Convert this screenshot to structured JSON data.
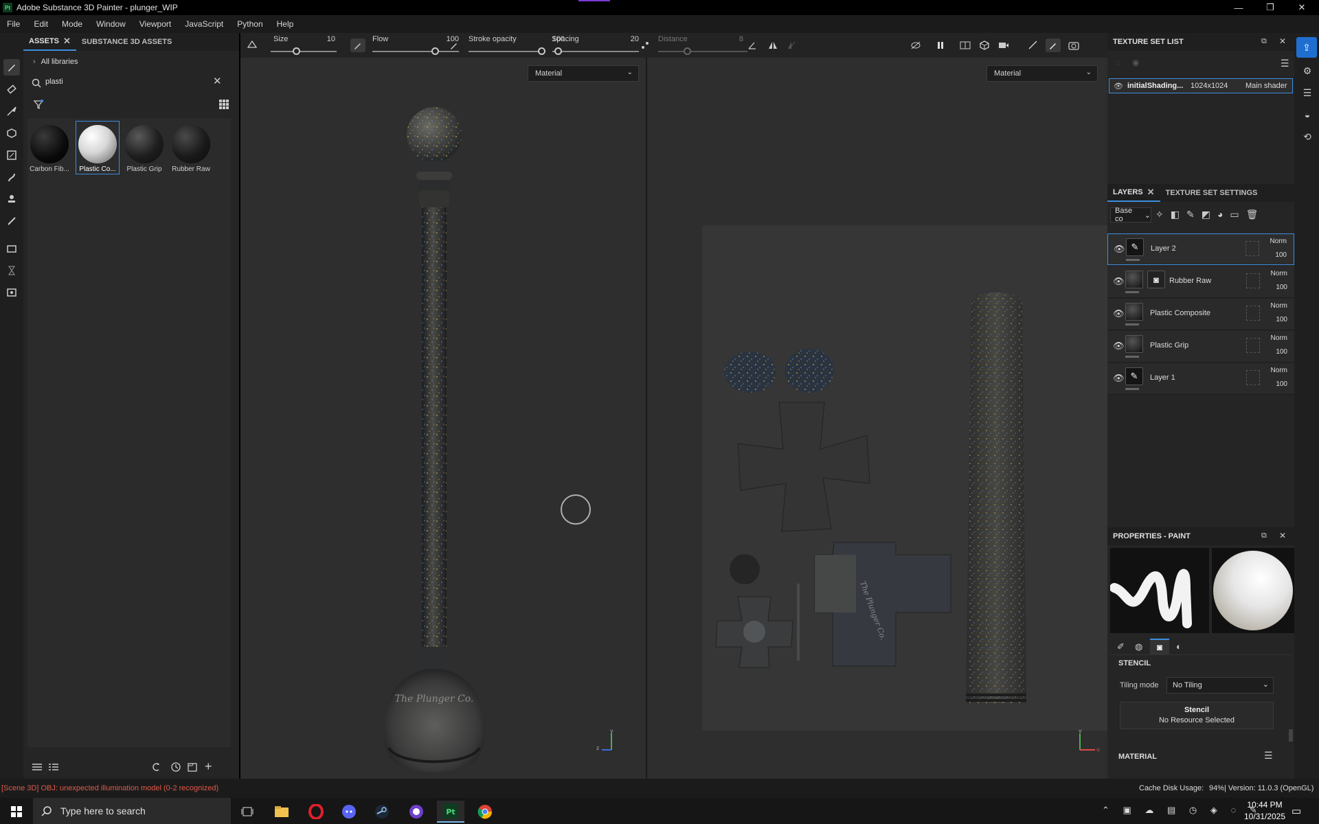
{
  "app": {
    "logo_text": "Pt",
    "title": "Adobe Substance 3D Painter - plunger_WIP"
  },
  "window_controls": {
    "minimize": "—",
    "maximize": "❐",
    "close": "✕"
  },
  "menu": [
    "File",
    "Edit",
    "Mode",
    "Window",
    "Viewport",
    "JavaScript",
    "Python",
    "Help"
  ],
  "assets_panel": {
    "tabs": [
      "ASSETS",
      "SUBSTANCE 3D ASSETS"
    ],
    "breadcrumb": "All libraries",
    "search_value": "plasti",
    "materials": [
      {
        "label": "Carbon Fib..."
      },
      {
        "label": "Plastic Co..."
      },
      {
        "label": "Plastic Grip"
      },
      {
        "label": "Rubber Raw"
      }
    ]
  },
  "toolbar": {
    "size_label": "Size",
    "size_value": "10",
    "flow_label": "Flow",
    "flow_value": "100",
    "stroke_label": "Stroke opacity",
    "stroke_value": "100",
    "spacing_label": "Spacing",
    "spacing_value": "20",
    "distance_label": "Distance",
    "distance_value": "8"
  },
  "viewport": {
    "left_mode": "Material",
    "right_mode": "Material",
    "brand_text": "The Plunger Co."
  },
  "texture_set_list": {
    "title": "TEXTURE SET LIST",
    "set_name": "initialShading...",
    "set_size": "1024x1024",
    "shader": "Main shader"
  },
  "layers_panel": {
    "tabs": [
      "LAYERS",
      "TEXTURE SET SETTINGS"
    ],
    "channel": "Base co",
    "layers": [
      {
        "name": "Layer 2",
        "blend": "Norm",
        "opacity": "100"
      },
      {
        "name": "Rubber Raw",
        "blend": "Norm",
        "opacity": "100"
      },
      {
        "name": "Plastic Composite",
        "blend": "Norm",
        "opacity": "100"
      },
      {
        "name": "Plastic Grip",
        "blend": "Norm",
        "opacity": "100"
      },
      {
        "name": "Layer 1",
        "blend": "Norm",
        "opacity": "100"
      }
    ]
  },
  "properties_panel": {
    "title": "PROPERTIES - PAINT",
    "section_stencil": "STENCIL",
    "tiling_label": "Tiling mode",
    "tiling_value": "No Tiling",
    "stencil_title": "Stencil",
    "stencil_sub": "No Resource Selected",
    "section_material": "MATERIAL"
  },
  "status_bar": {
    "message": "[Scene 3D] OBJ: unexpected illumination model (0-2 recognized)",
    "cache_label": "Cache Disk Usage:",
    "cache_value": "94%",
    "version": "| Version: 11.0.3 (OpenGL)"
  },
  "taskbar": {
    "search_placeholder": "Type here to search",
    "time": "10:44 PM",
    "date": "10/31/2025"
  },
  "colors": {
    "accent": "#3d8ee0",
    "error_text": "#e05a4a",
    "panel": "#252525",
    "viewport": "#2e2e2e"
  }
}
